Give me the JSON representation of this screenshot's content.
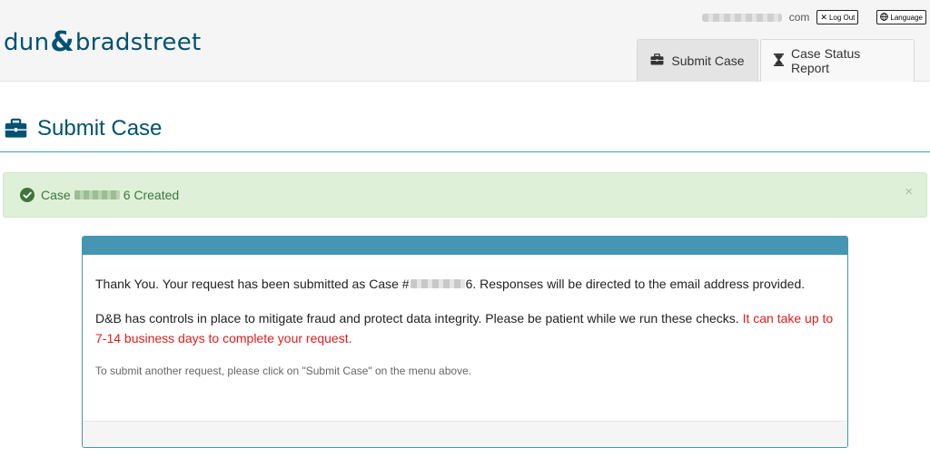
{
  "header": {
    "logo_left": "dun",
    "logo_amp": "&",
    "logo_right": "bradstreet",
    "email_suffix": "com",
    "logout_label": "Log Out",
    "language_label": "Language"
  },
  "tabs": [
    {
      "label": "Submit Case",
      "icon": "briefcase-icon",
      "active": true
    },
    {
      "label": "Case Status Report",
      "icon": "hourglass-icon",
      "active": false
    }
  ],
  "page": {
    "title": "Submit Case",
    "title_icon": "briefcase-icon"
  },
  "alert": {
    "prefix": "Case",
    "suffix": "6 Created",
    "close": "×",
    "color": "#3c763d"
  },
  "panel": {
    "p1_a": "Thank You. Your request has been submitted as Case #",
    "p1_b": "6. Responses will be directed to the email address provided.",
    "p2_a": "D&B has controls in place to mitigate fraud and protect data integrity. Please be patient while we run these checks. ",
    "p2_warn": "It can take up to 7-14 business days to complete your request.",
    "p3": "To submit another request, please click on \"Submit Case\" on the menu above."
  },
  "colors": {
    "brand": "#005172",
    "panel_header": "#4496b3",
    "warning": "#e41c1c",
    "success_bg": "#dff0d8"
  }
}
